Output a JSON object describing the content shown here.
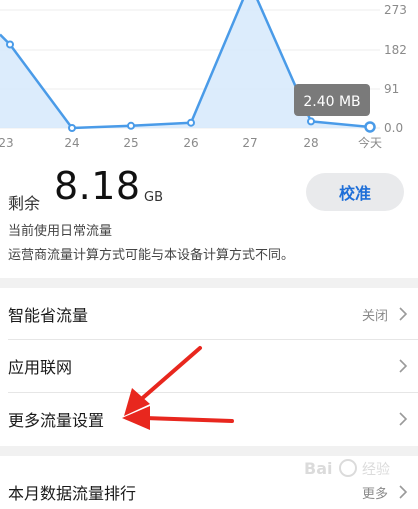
{
  "chart_data": {
    "type": "area",
    "categories": [
      "23",
      "24",
      "25",
      "26",
      "27",
      "28",
      "今天"
    ],
    "values": [
      190,
      0,
      5,
      12,
      330,
      15,
      2.4
    ],
    "y_ticks": [
      "273",
      "182",
      "91",
      "0.0"
    ],
    "ylim": [
      0,
      273
    ],
    "tooltip": "2.40 MB",
    "line_color": "#4a9be8",
    "fill_color": "#d6e9fb"
  },
  "usage": {
    "remain_label": "剩余",
    "remain_value": "8.18",
    "remain_unit": "GB",
    "calibrate_label": "校准",
    "note1": "当前使用日常流量",
    "note2": "运营商流量计算方式可能与本设备计算方式不同。"
  },
  "settings": [
    {
      "label": "智能省流量",
      "value": "关闭"
    },
    {
      "label": "应用联网",
      "value": ""
    },
    {
      "label": "更多流量设置",
      "value": ""
    },
    {
      "label": "本月数据流量排行",
      "value": "更多"
    }
  ],
  "colors": {
    "accent": "#1f6fd8",
    "arrow": "#e8271e"
  },
  "watermark": {
    "text": "Bai 经验"
  }
}
